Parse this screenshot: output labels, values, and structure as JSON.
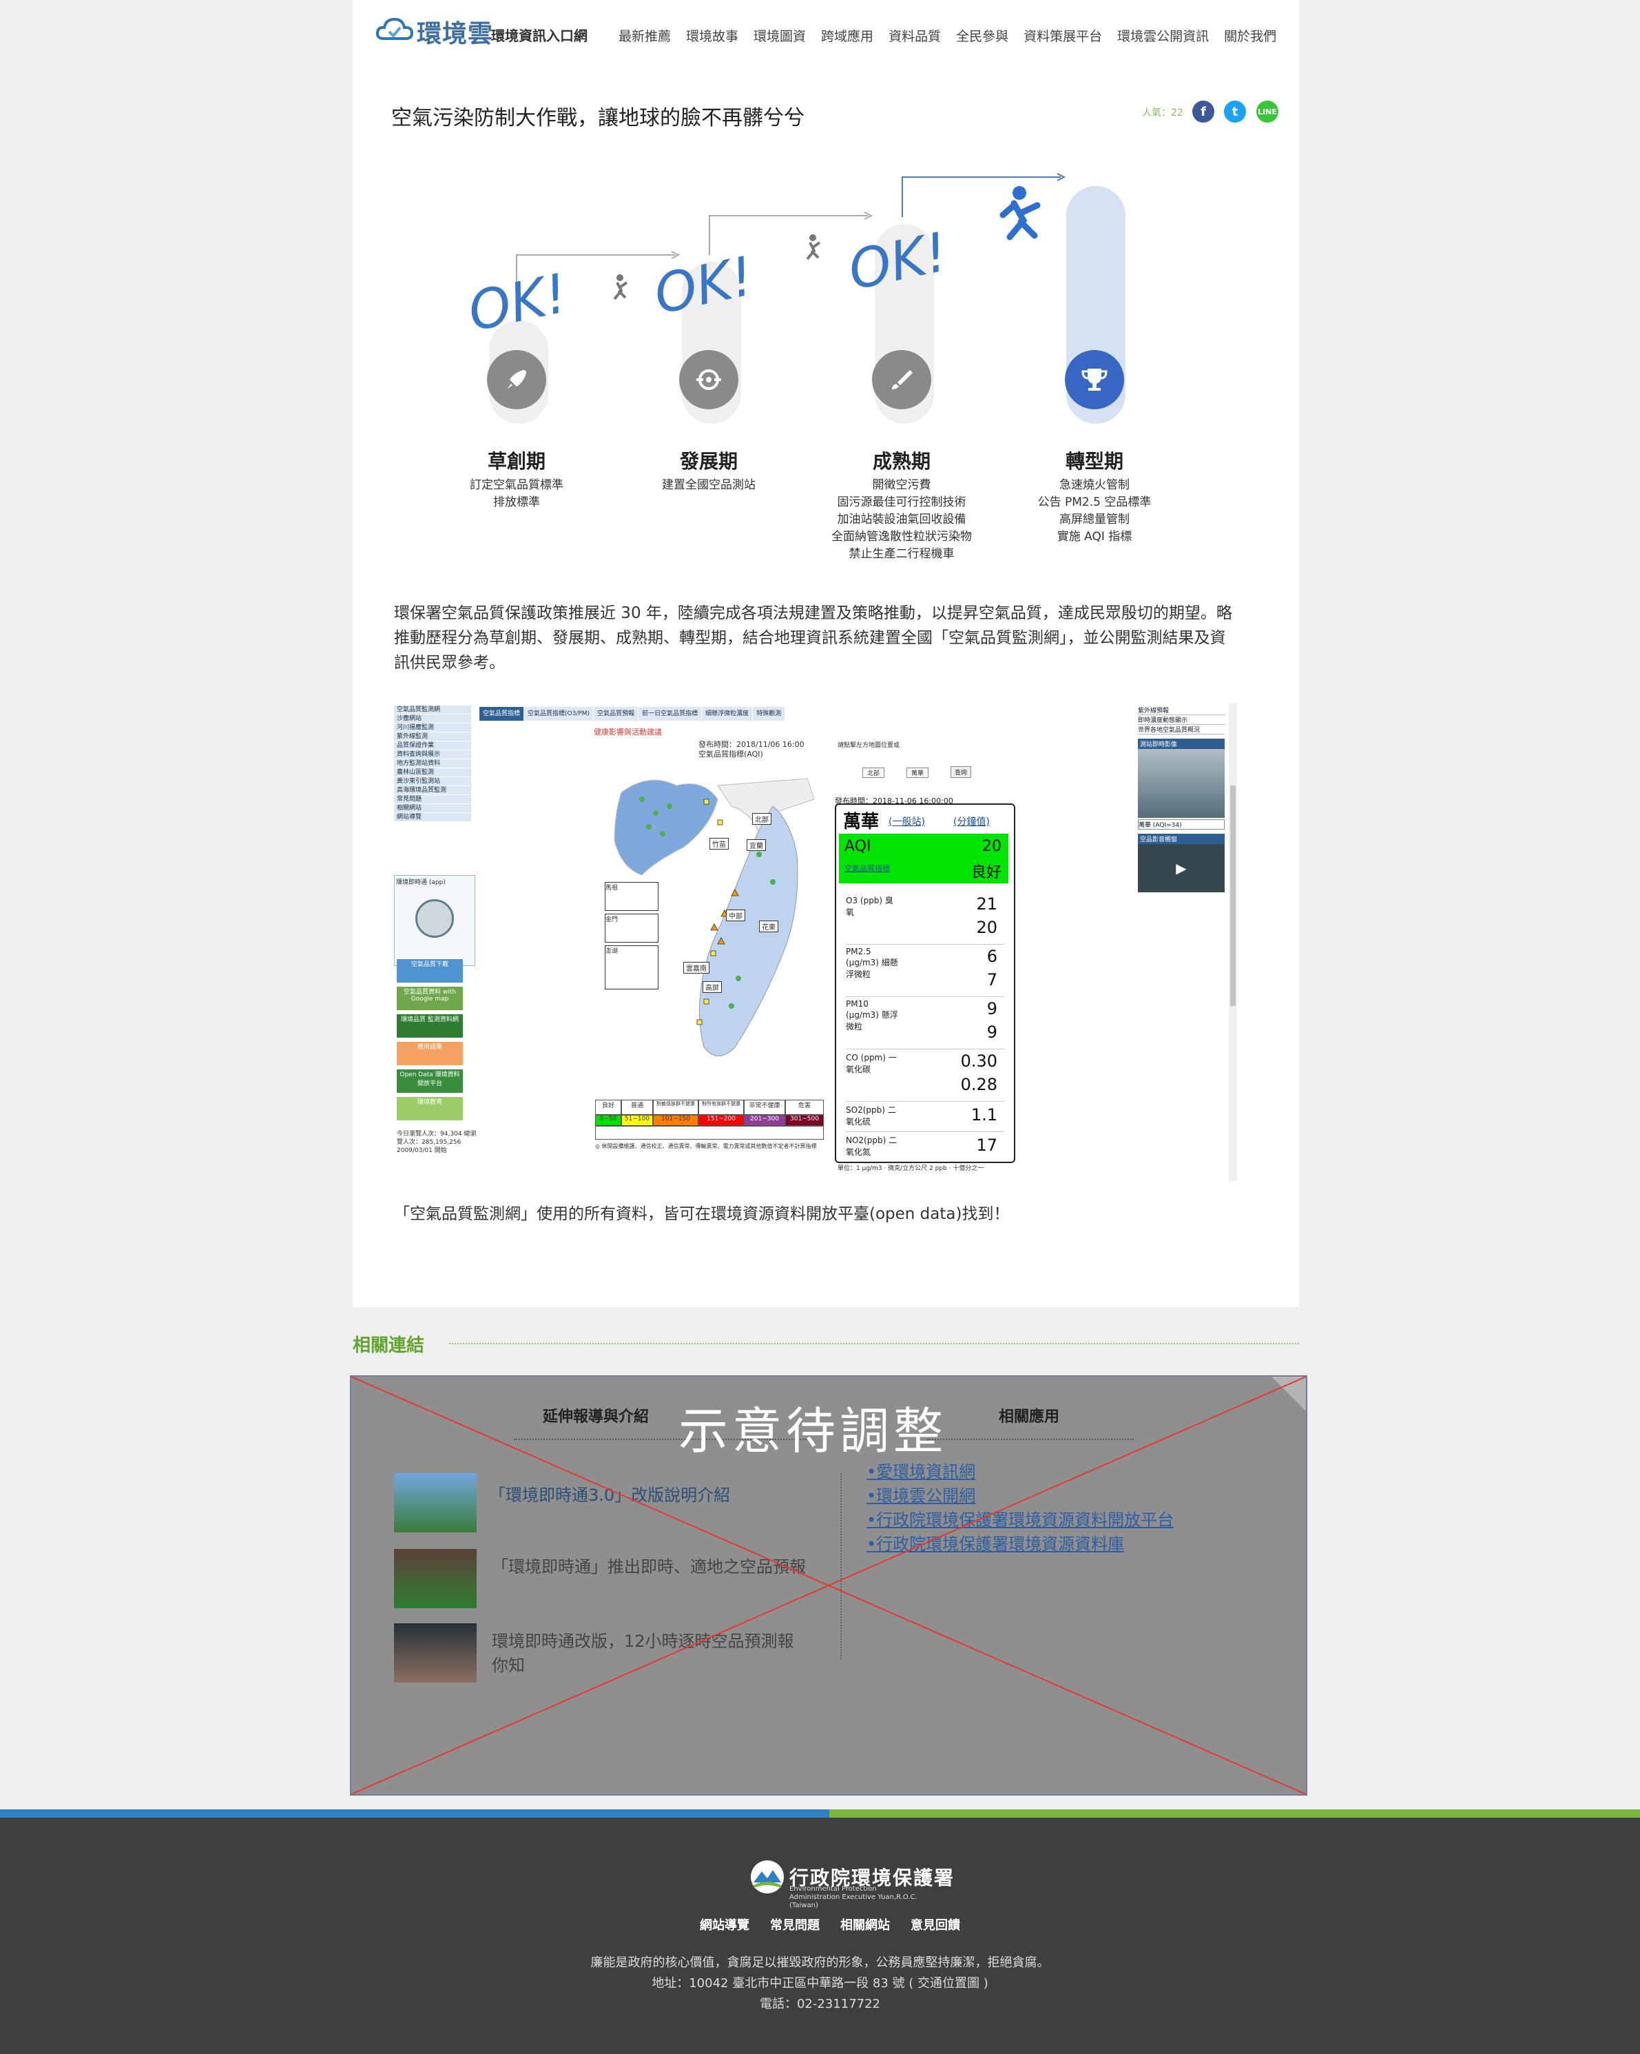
{
  "header": {
    "logo_text": "環境雲",
    "logo_sub": "環境資訊入口網",
    "nav": [
      "最新推薦",
      "環境故事",
      "環境圖資",
      "跨域應用",
      "資料品質",
      "全民參與",
      "資料策展平台",
      "環境雲公開資訊",
      "關於我們"
    ]
  },
  "article": {
    "title": "空氣污染防制大作戰，讓地球的臉不再髒兮兮",
    "popularity": "人氣：22",
    "social": [
      "facebook",
      "twitter",
      "line"
    ],
    "ok_label": "OK!",
    "phases": [
      {
        "title": "草創期",
        "icon": "rocket-icon",
        "items": [
          "訂定空氣品質標準",
          "排放標準"
        ]
      },
      {
        "title": "發展期",
        "icon": "target-icon",
        "items": [
          "建置全國空品測站"
        ]
      },
      {
        "title": "成熟期",
        "icon": "brush-icon",
        "items": [
          "開徵空污費",
          "固污源最佳可行控制技術",
          "加油站裝設油氣回收設備",
          "全面納管逸散性粒狀污染物",
          "禁止生產二行程機車"
        ]
      },
      {
        "title": "轉型期",
        "icon": "trophy-icon",
        "items": [
          "急速燒火管制",
          "公告 PM2.5 空品標準",
          "高屏總量管制",
          "實施 AQI 指標"
        ]
      }
    ],
    "paragraph": "環保署空氣品質保護政策推展近 30 年，陸續完成各項法規建置及策略推動，以提昇空氣品質，達成民眾殷切的期望。略推動歷程分為草創期、發展期、成熟期、轉型期，結合地理資訊系統建置全國「空氣品質監測網」，並公開監測結果及資訊供民眾參考。",
    "caption": "「空氣品質監測網」使用的所有資料，皆可在環境資源資料開放平臺(open data)找到！"
  },
  "screenshot": {
    "left_menu": [
      "空氣品質監測網",
      "沙塵網站",
      "河川揚塵監測",
      "紫外線監測",
      "品質保證作業",
      "資料查詢與展示",
      "地方監測站資料",
      "農林山區監測",
      "黃沙東引監測站",
      "高海環境品質監測",
      "常見問題",
      "相關網站",
      "網站導覽"
    ],
    "left_app_label": "環境即時通 (app)",
    "left_banners": [
      "空氣品質下載",
      "空氣品質資料 with Google map",
      "環境品質 監測資料網",
      "應用成果",
      "Open Data 環境資料開放平台",
      "環境教育"
    ],
    "left_counter": "今日瀏覽人次：94,304 總瀏覽人次：285,195,256 2009/03/01 開始",
    "tabs": [
      "空氣品質指標",
      "空氣品質指標(O3/PM)",
      "空氣品質預報",
      "前一日空氣品質指標",
      "細懸浮微粒濃度",
      "特殊觀測"
    ],
    "health_note": "健康影響與活動建議",
    "publish_time": "發布時間：2018/11/06 16:00",
    "index_label": "空氣品質指標(AQI)",
    "select_hint": "請點擊左方地圖位置或",
    "region_select": "北部",
    "station_select": "萬華",
    "query_label": "查詢",
    "regions": [
      "北部",
      "竹苗",
      "宜蘭",
      "中部",
      "花東",
      "雲嘉南",
      "高屏",
      "馬祖",
      "金門",
      "澎湖"
    ],
    "panel": {
      "publish": "發布時間：2018-11-06 16:00:00",
      "station": "萬華",
      "station_type": "(一般站)",
      "minute_link": "(分鐘值)",
      "aqi_label": "AQI",
      "aqi_value": "20",
      "aqi_status": "良好",
      "aqi_sub": "空氣品質指標",
      "rows": [
        {
          "name": "O3 (ppb) 臭氧",
          "v1": "21",
          "v2": "20"
        },
        {
          "name": "PM2.5 (μg/m3) 細懸浮微粒",
          "v1": "6",
          "v2": "7"
        },
        {
          "name": "PM10 (μg/m3) 懸浮微粒",
          "v1": "9",
          "v2": "9"
        },
        {
          "name": "CO (ppm) 一氧化碳",
          "v1": "0.30",
          "v2": "0.28"
        },
        {
          "name": "SO2(ppb) 二氧化硫",
          "v1": "1.1",
          "v2": ""
        },
        {
          "name": "NO2(ppb) 二氧化氮",
          "v1": "17",
          "v2": ""
        }
      ],
      "unit_note": "單位：1 μg/m3 · 微克/立方公尺 2 ppb · 十億分之一"
    },
    "legend": {
      "labels": [
        "良好",
        "普通",
        "對敏感族群不健康",
        "對所有族群不健康",
        "非常不健康",
        "危害"
      ],
      "ranges": [
        "0~50",
        "51~100",
        "101~150",
        "151~200",
        "201~300",
        "301~500"
      ],
      "colors": [
        "#00e400",
        "#ffff00",
        "#ff7e00",
        "#ff0000",
        "#8f3f97",
        "#7e0023"
      ],
      "note": "◎ 休閒設備維護、通信校正、通信異常、傳輸異常、電力異常或其他數值不定者不計算指標"
    },
    "right_panel": [
      "紫外線預報",
      "即時濃度動態顯示",
      "世界各地空氣品質概況",
      "測站即時影像",
      "萬華 (AQI=34)",
      "空品影音櫥窗"
    ]
  },
  "related": {
    "label": "相關連結",
    "col1_title": "延伸報導與介紹",
    "col2_title": "相關應用",
    "watermark": "示意待調整",
    "articles": [
      "「環境即時通3.0」改版說明介紹",
      "「環境即時通」推出即時、適地之空品預報",
      "環境即時通改版，12小時逐時空品預測報你知"
    ],
    "links": [
      "•愛環境資訊網",
      "•環境雲公開網",
      "•行政院環境保護署環境資源資料開放平台",
      "•行政院環境保護署環境資源資料庫"
    ]
  },
  "footer": {
    "logo_text": "行政院環境保護署",
    "logo_sub": "Environmental Protection Administration Executive Yuan,R.O.C.(Taiwan)",
    "links": [
      "網站導覽",
      "常見問題",
      "相關網站",
      "意見回饋"
    ],
    "motto": "廉能是政府的核心價值，貪腐足以摧毀政府的形象，公務員應堅持廉潔，拒絕貪腐。",
    "address": "地址：10042 臺北市中正區中華路一段 83 號 ( 交通位置圖 )",
    "phone": "電話：02-23117722"
  }
}
